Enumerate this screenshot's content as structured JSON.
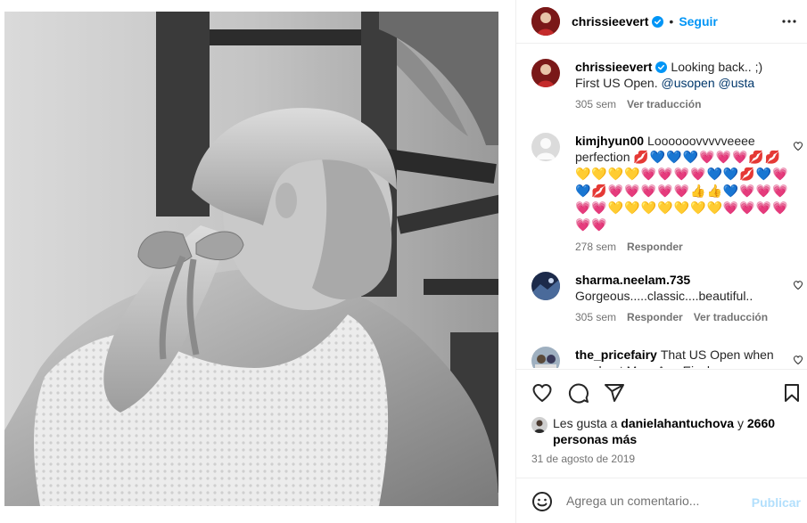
{
  "post": {
    "username": "chrissieevert",
    "follow_label": "Seguir",
    "separator": "•",
    "photo_alt": "black and white photo of a girl with a ponytail and bow"
  },
  "caption": {
    "username": "chrissieevert",
    "text": "Looking back.. ;) First US Open.",
    "mention_1": "@usopen",
    "mention_2": "@usta",
    "time": "305 sem",
    "translate": "Ver traducción"
  },
  "comments": [
    {
      "username": "kimjhyun00",
      "text": "Loooooovvvvveeee perfection",
      "emoji": "💋💙💙💙💗💗💗💋💋💛💛💛💛💗💗💗💗💙💙💋💙💗💙💋💗💗💗💗💗👍👍💙💗💗💗💗💗💛💛💛💛💛💛💛💗💗💗💗💗💗",
      "time": "278 sem",
      "reply": "Responder"
    },
    {
      "username": "sharma.neelam.735",
      "text": "Gorgeous.....classic....beautiful..",
      "time": "305 sem",
      "reply": "Responder",
      "translate": "Ver traducción"
    },
    {
      "username": "the_pricefairy",
      "text": "That US Open when you beat Mary Ann Eisel ..."
    }
  ],
  "likes": {
    "prefix": "Les gusta a",
    "user": "danielahantuchova",
    "joiner": "y",
    "count": "2660",
    "suffix": "personas más"
  },
  "date": "31 de agosto de 2019",
  "composer": {
    "placeholder": "Agrega un comentario...",
    "publish": "Publicar"
  },
  "icons": {
    "more": "more-horizontal-icon",
    "like": "heart-icon",
    "comment": "comment-icon",
    "share": "share-icon",
    "save": "bookmark-icon",
    "emoji": "smiley-icon",
    "verified": "verified-badge-icon"
  },
  "colors": {
    "accent": "#0095f6",
    "verified": "#0095f6",
    "muted": "#737373",
    "publish_disabled": "#b2dffc"
  }
}
